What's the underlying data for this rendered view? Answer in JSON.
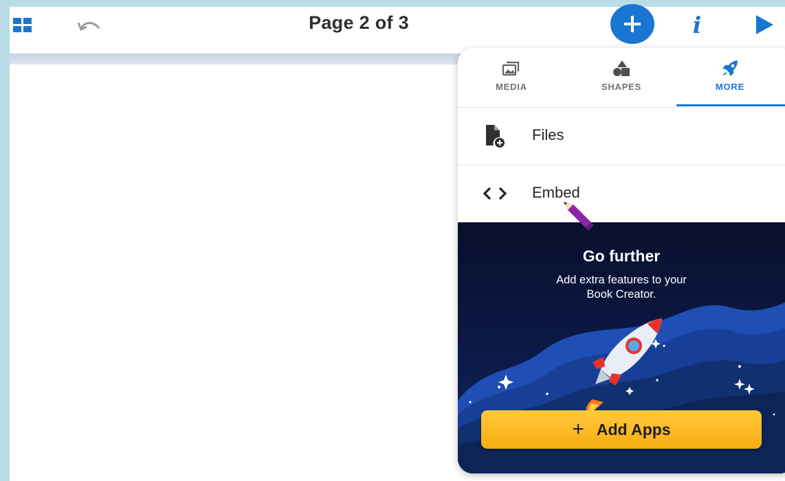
{
  "toolbar": {
    "page_title": "Page 2 of 3",
    "grid_icon": "grid-icon",
    "undo_icon": "undo-icon",
    "add_icon": "plus-icon",
    "info_label": "i",
    "play_icon": "play-icon",
    "accent": "#1976d2"
  },
  "panel": {
    "tabs": [
      {
        "label": "MEDIA",
        "icon": "media-icon"
      },
      {
        "label": "SHAPES",
        "icon": "shapes-icon"
      },
      {
        "label": "MORE",
        "icon": "rocket-icon",
        "active": true
      }
    ],
    "items": [
      {
        "label": "Files",
        "icon": "file-add-icon"
      },
      {
        "label": "Embed",
        "icon": "code-icon"
      }
    ],
    "promo": {
      "title": "Go further",
      "subtitle_line1": "Add extra features to your",
      "subtitle_line2": "Book Creator.",
      "button_plus": "+",
      "button_label": "Add Apps",
      "button_color": "#f7ad14"
    }
  }
}
